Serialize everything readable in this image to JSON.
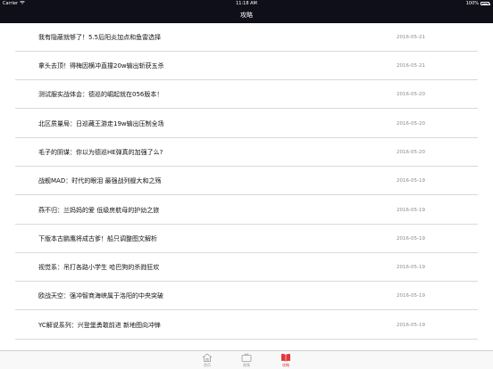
{
  "status_bar": {
    "carrier": "Carrier",
    "time": "11:18 AM",
    "battery": "100%"
  },
  "nav": {
    "title": "攻略"
  },
  "articles": [
    {
      "title": "我有隐蔽就够了！5.5后阳炎加点和鱼雷选择",
      "date": "2016-05-21"
    },
    {
      "title": "拿头去顶！得梅因横冲直撞20w输出斩获五杀",
      "date": "2016-05-21"
    },
    {
      "title": "测试服实战体会：德巡的崛起就在056版本！",
      "date": "2016-05-20"
    },
    {
      "title": "北区质量局：日巡藏王游走19w输出压制全场",
      "date": "2016-05-20"
    },
    {
      "title": "毛子的阴谋：你以为德巡HE弹真的加强了么?",
      "date": "2016-05-20"
    },
    {
      "title": "战舰MAD：时代的眼泪 最强战列舰大和之殇",
      "date": "2016-05-19"
    },
    {
      "title": "燕不归：兰妈妈的爱 低级房航母的护幼之旅",
      "date": "2016-05-19"
    },
    {
      "title": "下版本古鹏鹰将成古爹！船只调整图文解析",
      "date": "2016-05-19"
    },
    {
      "title": "视觉系：吊打各路小学生 哈巴狗的杀戮狂欢",
      "date": "2016-05-19"
    },
    {
      "title": "欧战天空：强冲智商海峡属于洛阳的中央突破",
      "date": "2016-05-19"
    },
    {
      "title": "YC解说系列：兴登堡勇敢前进 新地图向冲锋",
      "date": "2016-05-19"
    }
  ],
  "tabs": [
    {
      "label": "首页",
      "icon": "home-icon",
      "active": false
    },
    {
      "label": "视频",
      "icon": "tv-icon",
      "active": false
    },
    {
      "label": "攻略",
      "icon": "book-icon",
      "active": true
    }
  ],
  "colors": {
    "bar_bg": "#0f0f1a",
    "accent": "#e0393e",
    "tab_inactive": "#9a9a9a"
  }
}
